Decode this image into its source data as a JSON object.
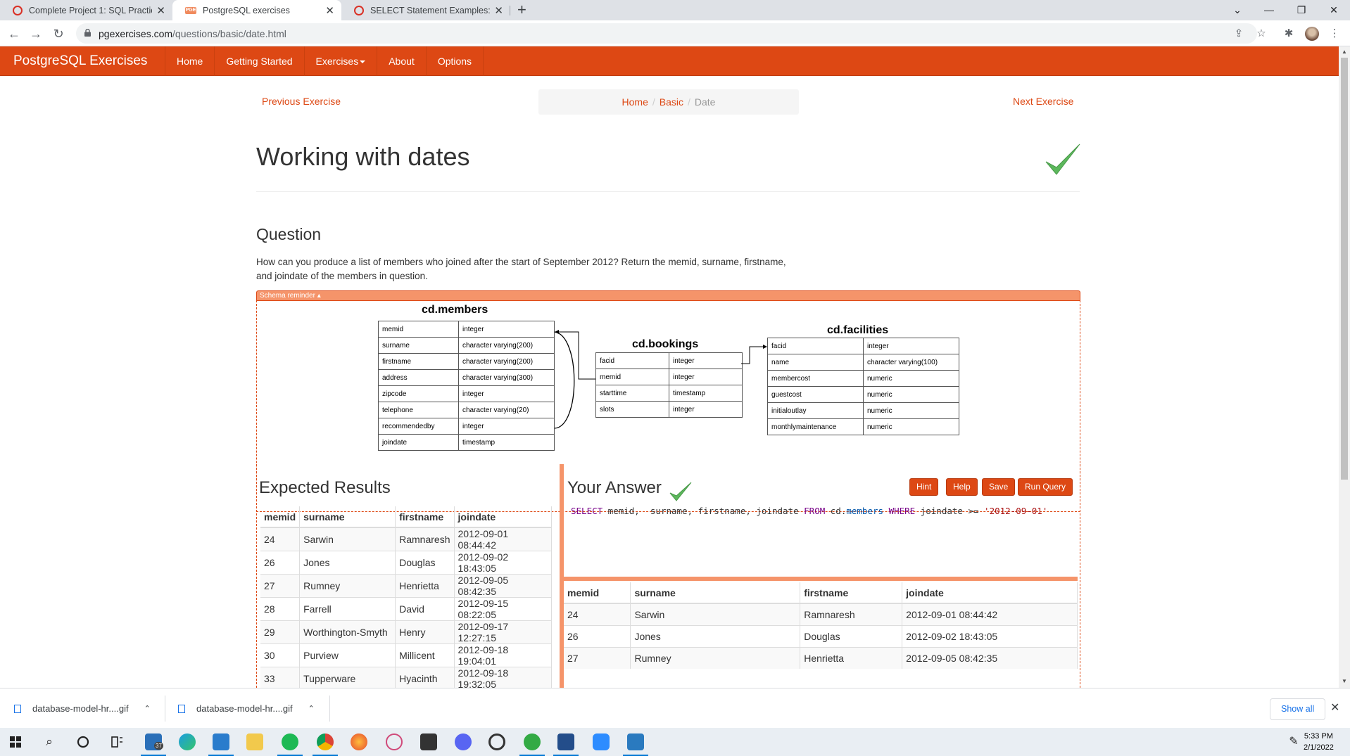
{
  "browser": {
    "tabs": [
      {
        "title": "Complete Project 1: SQL Practice",
        "active": false
      },
      {
        "title": "PostgreSQL exercises",
        "active": true
      },
      {
        "title": "SELECT Statement Examples: FSW",
        "active": false
      }
    ],
    "url_host": "pgexercises.com",
    "url_path": "/questions/basic/date.html"
  },
  "nav": {
    "brand": "PostgreSQL Exercises",
    "links": [
      "Home",
      "Getting Started",
      "Exercises",
      "About",
      "Options"
    ]
  },
  "pager": {
    "prev": "Previous Exercise",
    "next": "Next Exercise",
    "breadcrumb": [
      "Home",
      "Basic",
      "Date"
    ]
  },
  "page": {
    "title": "Working with dates",
    "question_heading": "Question",
    "question_text": "How can you produce a list of members who joined after the start of September 2012? Return the memid, surname, firstname, and joindate of the members in question."
  },
  "schema": {
    "toggle_label": "Schema reminder ▴",
    "members": {
      "title": "cd.members",
      "rows": [
        [
          "memid",
          "integer"
        ],
        [
          "surname",
          "character varying(200)"
        ],
        [
          "firstname",
          "character varying(200)"
        ],
        [
          "address",
          "character varying(300)"
        ],
        [
          "zipcode",
          "integer"
        ],
        [
          "telephone",
          "character varying(20)"
        ],
        [
          "recommendedby",
          "integer"
        ],
        [
          "joindate",
          "timestamp"
        ]
      ]
    },
    "bookings": {
      "title": "cd.bookings",
      "rows": [
        [
          "facid",
          "integer"
        ],
        [
          "memid",
          "integer"
        ],
        [
          "starttime",
          "timestamp"
        ],
        [
          "slots",
          "integer"
        ]
      ]
    },
    "facilities": {
      "title": "cd.facilities",
      "rows": [
        [
          "facid",
          "integer"
        ],
        [
          "name",
          "character varying(100)"
        ],
        [
          "membercost",
          "numeric"
        ],
        [
          "guestcost",
          "numeric"
        ],
        [
          "initialoutlay",
          "numeric"
        ],
        [
          "monthlymaintenance",
          "numeric"
        ]
      ]
    }
  },
  "expected": {
    "heading": "Expected Results",
    "columns": [
      "memid",
      "surname",
      "firstname",
      "joindate"
    ],
    "rows": [
      [
        "24",
        "Sarwin",
        "Ramnaresh",
        "2012-09-01 08:44:42"
      ],
      [
        "26",
        "Jones",
        "Douglas",
        "2012-09-02 18:43:05"
      ],
      [
        "27",
        "Rumney",
        "Henrietta",
        "2012-09-05 08:42:35"
      ],
      [
        "28",
        "Farrell",
        "David",
        "2012-09-15 08:22:05"
      ],
      [
        "29",
        "Worthington-Smyth",
        "Henry",
        "2012-09-17 12:27:15"
      ],
      [
        "30",
        "Purview",
        "Millicent",
        "2012-09-18 19:04:01"
      ],
      [
        "33",
        "Tupperware",
        "Hyacinth",
        "2012-09-18 19:32:05"
      ]
    ]
  },
  "answer": {
    "heading": "Your Answer",
    "buttons": [
      "Hint",
      "Help",
      "Save",
      "Run Query"
    ],
    "query": {
      "kw_select": "SELECT",
      "cols": " memid,  surname, firstname, joindate ",
      "kw_from": "FROM",
      "table_schema": " cd.",
      "table_name": "members",
      "kw_where": " WHERE",
      "cond": " joindate >= ",
      "literal": "'2012-09-01'"
    },
    "columns": [
      "memid",
      "surname",
      "firstname",
      "joindate"
    ],
    "rows": [
      [
        "24",
        "Sarwin",
        "Ramnaresh",
        "2012-09-01 08:44:42"
      ],
      [
        "26",
        "Jones",
        "Douglas",
        "2012-09-02 18:43:05"
      ],
      [
        "27",
        "Rumney",
        "Henrietta",
        "2012-09-05 08:42:35"
      ]
    ]
  },
  "downloads": {
    "items": [
      "database-model-hr....gif",
      "database-model-hr....gif"
    ],
    "show_all": "Show all"
  },
  "taskbar": {
    "time": "5:33 PM",
    "date": "2/1/2022",
    "mail_badge": "37"
  },
  "colors": {
    "accent": "#dd4814",
    "accent_light": "#f5946a",
    "check_green": "#5cb85c"
  }
}
